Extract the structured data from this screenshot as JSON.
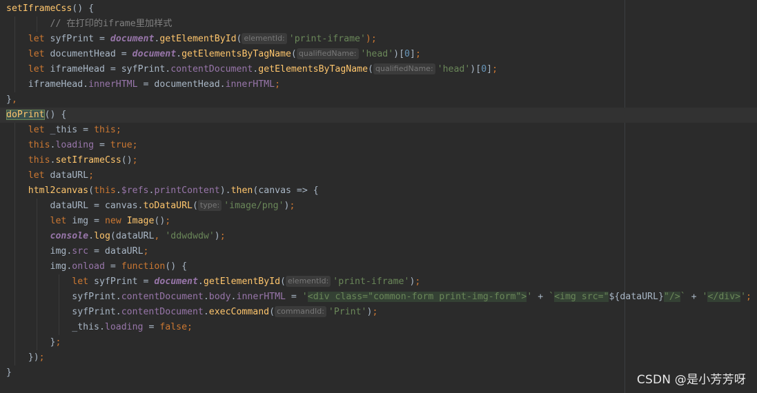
{
  "editor": {
    "lines": [
      {
        "tokens": [
          {
            "t": "setIframeCss",
            "c": "fn"
          },
          {
            "t": "() {",
            "c": "p"
          }
        ]
      },
      {
        "tokens": [
          {
            "t": "        // 在打印的iframe里加样式",
            "c": "cmt"
          }
        ]
      },
      {
        "tokens": [
          {
            "t": "    ",
            "c": "p"
          },
          {
            "t": "let ",
            "c": "kw"
          },
          {
            "t": "syfPrint = ",
            "c": "p"
          },
          {
            "t": "document",
            "c": "gl"
          },
          {
            "t": ".",
            "c": "p"
          },
          {
            "t": "getElementById",
            "c": "fn"
          },
          {
            "t": "(",
            "c": "p"
          },
          {
            "t": "elementId:",
            "c": "hint"
          },
          {
            "t": "'print-iframe'",
            "c": "str"
          },
          {
            "t": ");",
            "c": "kw"
          }
        ]
      },
      {
        "tokens": [
          {
            "t": "    ",
            "c": "p"
          },
          {
            "t": "let ",
            "c": "kw"
          },
          {
            "t": "documentHead = ",
            "c": "p"
          },
          {
            "t": "document",
            "c": "gl"
          },
          {
            "t": ".",
            "c": "p"
          },
          {
            "t": "getElementsByTagName",
            "c": "fn"
          },
          {
            "t": "(",
            "c": "p"
          },
          {
            "t": "qualifiedName:",
            "c": "hint"
          },
          {
            "t": "'head'",
            "c": "str"
          },
          {
            "t": ")[",
            "c": "p"
          },
          {
            "t": "0",
            "c": "num"
          },
          {
            "t": "]",
            "c": "p"
          },
          {
            "t": ";",
            "c": "kw"
          }
        ]
      },
      {
        "tokens": [
          {
            "t": "    ",
            "c": "p"
          },
          {
            "t": "let ",
            "c": "kw"
          },
          {
            "t": "iframeHead = syfPrint.",
            "c": "p"
          },
          {
            "t": "contentDocument",
            "c": "prop"
          },
          {
            "t": ".",
            "c": "p"
          },
          {
            "t": "getElementsByTagName",
            "c": "fn"
          },
          {
            "t": "(",
            "c": "p"
          },
          {
            "t": "qualifiedName:",
            "c": "hint"
          },
          {
            "t": "'head'",
            "c": "str"
          },
          {
            "t": ")[",
            "c": "p"
          },
          {
            "t": "0",
            "c": "num"
          },
          {
            "t": "]",
            "c": "p"
          },
          {
            "t": ";",
            "c": "kw"
          }
        ]
      },
      {
        "tokens": [
          {
            "t": "    iframeHead.",
            "c": "p"
          },
          {
            "t": "innerHTML",
            "c": "prop"
          },
          {
            "t": " = documentHead.",
            "c": "p"
          },
          {
            "t": "innerHTML",
            "c": "prop"
          },
          {
            "t": ";",
            "c": "kw"
          }
        ]
      },
      {
        "tokens": [
          {
            "t": "}",
            "c": "p"
          },
          {
            "t": ",",
            "c": "kw"
          }
        ]
      },
      {
        "active": true,
        "tokens": [
          {
            "t": "doPrint",
            "c": "fn sel"
          },
          {
            "t": "() {",
            "c": "p"
          }
        ]
      },
      {
        "tokens": [
          {
            "t": "    ",
            "c": "p"
          },
          {
            "t": "let ",
            "c": "kw"
          },
          {
            "t": "_this = ",
            "c": "p"
          },
          {
            "t": "this",
            "c": "kw"
          },
          {
            "t": ";",
            "c": "kw"
          }
        ]
      },
      {
        "tokens": [
          {
            "t": "    ",
            "c": "p"
          },
          {
            "t": "this",
            "c": "kw"
          },
          {
            "t": ".",
            "c": "p"
          },
          {
            "t": "loading",
            "c": "prop"
          },
          {
            "t": " = ",
            "c": "p"
          },
          {
            "t": "true",
            "c": "kw"
          },
          {
            "t": ";",
            "c": "kw"
          }
        ]
      },
      {
        "tokens": [
          {
            "t": "    ",
            "c": "p"
          },
          {
            "t": "this",
            "c": "kw"
          },
          {
            "t": ".",
            "c": "p"
          },
          {
            "t": "setIframeCss",
            "c": "fn"
          },
          {
            "t": "()",
            "c": "p"
          },
          {
            "t": ";",
            "c": "kw"
          }
        ]
      },
      {
        "tokens": [
          {
            "t": "    ",
            "c": "p"
          },
          {
            "t": "let ",
            "c": "kw"
          },
          {
            "t": "dataURL",
            "c": "p"
          },
          {
            "t": ";",
            "c": "kw"
          }
        ]
      },
      {
        "tokens": [
          {
            "t": "    ",
            "c": "p"
          },
          {
            "t": "html2canvas",
            "c": "fn"
          },
          {
            "t": "(",
            "c": "p"
          },
          {
            "t": "this",
            "c": "kw"
          },
          {
            "t": ".",
            "c": "p"
          },
          {
            "t": "$refs",
            "c": "prop"
          },
          {
            "t": ".",
            "c": "p"
          },
          {
            "t": "printContent",
            "c": "prop"
          },
          {
            "t": ").",
            "c": "p"
          },
          {
            "t": "then",
            "c": "fn"
          },
          {
            "t": "(canvas => {",
            "c": "p"
          }
        ]
      },
      {
        "tokens": [
          {
            "t": "        dataURL = canvas.",
            "c": "p"
          },
          {
            "t": "toDataURL",
            "c": "fn"
          },
          {
            "t": "(",
            "c": "p"
          },
          {
            "t": "type:",
            "c": "hint"
          },
          {
            "t": "'image/png'",
            "c": "str"
          },
          {
            "t": ")",
            "c": "p"
          },
          {
            "t": ";",
            "c": "kw"
          }
        ]
      },
      {
        "tokens": [
          {
            "t": "        ",
            "c": "p"
          },
          {
            "t": "let ",
            "c": "kw"
          },
          {
            "t": "img = ",
            "c": "p"
          },
          {
            "t": "new ",
            "c": "kw"
          },
          {
            "t": "Image",
            "c": "fn"
          },
          {
            "t": "()",
            "c": "p"
          },
          {
            "t": ";",
            "c": "kw"
          }
        ]
      },
      {
        "tokens": [
          {
            "t": "        ",
            "c": "p"
          },
          {
            "t": "console",
            "c": "gl"
          },
          {
            "t": ".",
            "c": "p"
          },
          {
            "t": "log",
            "c": "fn"
          },
          {
            "t": "(dataURL",
            "c": "p"
          },
          {
            "t": ", ",
            "c": "kw"
          },
          {
            "t": "'ddwdwdw'",
            "c": "str"
          },
          {
            "t": ")",
            "c": "p"
          },
          {
            "t": ";",
            "c": "kw"
          }
        ]
      },
      {
        "tokens": [
          {
            "t": "        img.",
            "c": "p"
          },
          {
            "t": "src",
            "c": "prop"
          },
          {
            "t": " = dataURL",
            "c": "p"
          },
          {
            "t": ";",
            "c": "kw"
          }
        ]
      },
      {
        "tokens": [
          {
            "t": "        img.",
            "c": "p"
          },
          {
            "t": "onload",
            "c": "prop"
          },
          {
            "t": " = ",
            "c": "p"
          },
          {
            "t": "function",
            "c": "kw"
          },
          {
            "t": "() {",
            "c": "p"
          }
        ]
      },
      {
        "tokens": [
          {
            "t": "            ",
            "c": "p"
          },
          {
            "t": "let ",
            "c": "kw"
          },
          {
            "t": "syfPrint = ",
            "c": "p"
          },
          {
            "t": "document",
            "c": "gl"
          },
          {
            "t": ".",
            "c": "p"
          },
          {
            "t": "getElementById",
            "c": "fn"
          },
          {
            "t": "(",
            "c": "p"
          },
          {
            "t": "elementId:",
            "c": "hint"
          },
          {
            "t": "'print-iframe'",
            "c": "str"
          },
          {
            "t": ")",
            "c": "p"
          },
          {
            "t": ";",
            "c": "kw"
          }
        ]
      },
      {
        "tokens": [
          {
            "t": "            syfPrint.",
            "c": "p"
          },
          {
            "t": "contentDocument",
            "c": "prop"
          },
          {
            "t": ".",
            "c": "p"
          },
          {
            "t": "body",
            "c": "prop"
          },
          {
            "t": ".",
            "c": "p"
          },
          {
            "t": "innerHTML",
            "c": "prop"
          },
          {
            "t": " = ",
            "c": "p"
          },
          {
            "t": "'",
            "c": "str"
          },
          {
            "t": "<div class=\"common-form print-img-form\">",
            "c": "str tagb"
          },
          {
            "t": "'",
            "c": "str"
          },
          {
            "t": " + ",
            "c": "p"
          },
          {
            "t": "`",
            "c": "str"
          },
          {
            "t": "<img src=\"",
            "c": "str tagb"
          },
          {
            "t": "${dataURL}",
            "c": "p"
          },
          {
            "t": "\"/>",
            "c": "str tagb"
          },
          {
            "t": "`",
            "c": "str"
          },
          {
            "t": " + ",
            "c": "p"
          },
          {
            "t": "'",
            "c": "str"
          },
          {
            "t": "</div>",
            "c": "str tagb"
          },
          {
            "t": "'",
            "c": "str"
          },
          {
            "t": ";",
            "c": "kw"
          }
        ]
      },
      {
        "tokens": [
          {
            "t": "            syfPrint.",
            "c": "p"
          },
          {
            "t": "contentDocument",
            "c": "prop"
          },
          {
            "t": ".",
            "c": "p"
          },
          {
            "t": "execCommand",
            "c": "fn"
          },
          {
            "t": "(",
            "c": "p"
          },
          {
            "t": "commandId:",
            "c": "hint"
          },
          {
            "t": "'Print'",
            "c": "str"
          },
          {
            "t": ")",
            "c": "p"
          },
          {
            "t": ";",
            "c": "kw"
          }
        ]
      },
      {
        "tokens": [
          {
            "t": "            _this.",
            "c": "p"
          },
          {
            "t": "loading",
            "c": "prop"
          },
          {
            "t": " = ",
            "c": "p"
          },
          {
            "t": "false",
            "c": "kw"
          },
          {
            "t": ";",
            "c": "kw"
          }
        ]
      },
      {
        "tokens": [
          {
            "t": "        }",
            "c": "p"
          },
          {
            "t": ";",
            "c": "kw"
          }
        ]
      },
      {
        "tokens": [
          {
            "t": "    })",
            "c": "p"
          },
          {
            "t": ";",
            "c": "kw"
          }
        ]
      },
      {
        "tokens": [
          {
            "t": "}",
            "c": "p"
          }
        ]
      }
    ]
  },
  "watermark": "CSDN @是小芳芳呀",
  "colors": {
    "background": "#2b2b2b",
    "keyword": "#cc7832",
    "function": "#ffc66d",
    "string": "#6a8759",
    "number": "#6897bb",
    "comment": "#808080",
    "property": "#9876aa",
    "text": "#a9b7c6"
  }
}
